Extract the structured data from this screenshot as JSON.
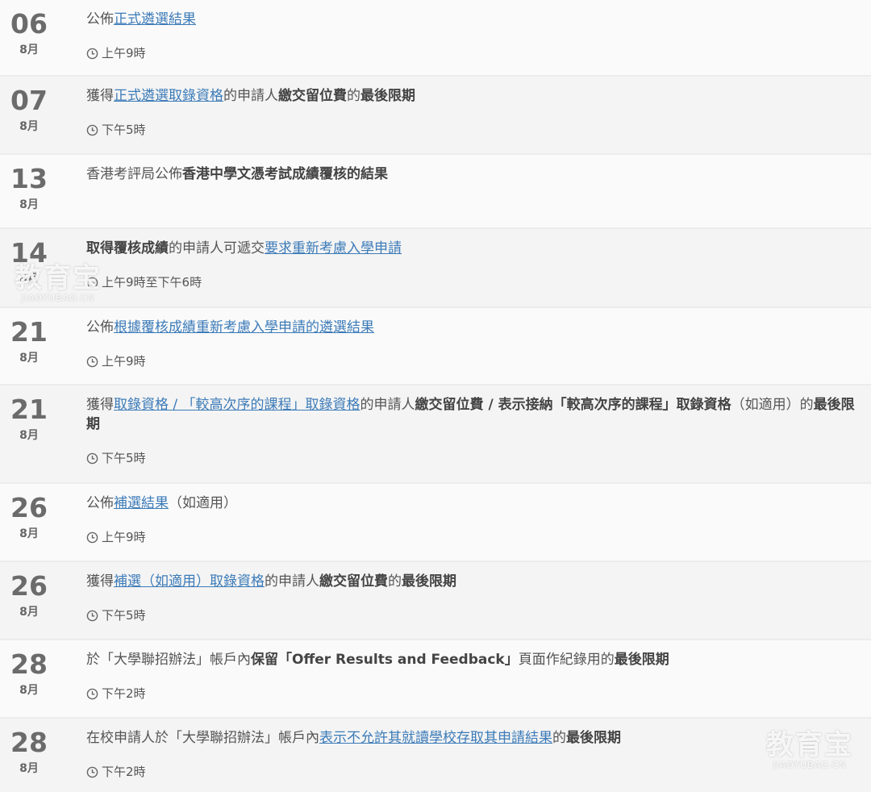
{
  "events": [
    {
      "day": "06",
      "month": "8月",
      "parts": [
        {
          "t": "text",
          "v": "公佈"
        },
        {
          "t": "link",
          "v": "正式遴選結果"
        }
      ],
      "time": "上午9時"
    },
    {
      "day": "07",
      "month": "8月",
      "parts": [
        {
          "t": "text",
          "v": "獲得"
        },
        {
          "t": "link",
          "v": "正式遴選取錄資格"
        },
        {
          "t": "text",
          "v": "的申請人"
        },
        {
          "t": "bold",
          "v": "繳交留位費"
        },
        {
          "t": "text",
          "v": "的"
        },
        {
          "t": "bold",
          "v": "最後限期"
        }
      ],
      "time": "下午5時"
    },
    {
      "day": "13",
      "month": "8月",
      "parts": [
        {
          "t": "text",
          "v": "香港考評局公佈"
        },
        {
          "t": "bold",
          "v": "香港中學文憑考試成績覆核的結果"
        }
      ],
      "time": ""
    },
    {
      "day": "14",
      "month": "8月",
      "parts": [
        {
          "t": "bold",
          "v": "取得覆核成績"
        },
        {
          "t": "text",
          "v": "的申請人可遞交"
        },
        {
          "t": "link",
          "v": "要求重新考慮入學申請"
        }
      ],
      "time": "上午9時至下午6時"
    },
    {
      "day": "21",
      "month": "8月",
      "parts": [
        {
          "t": "text",
          "v": "公佈"
        },
        {
          "t": "link",
          "v": "根據覆核成績重新考慮入學申請的遴選結果"
        }
      ],
      "time": "上午9時"
    },
    {
      "day": "21",
      "month": "8月",
      "parts": [
        {
          "t": "text",
          "v": "獲得"
        },
        {
          "t": "link",
          "v": "取錄資格 / 「較高次序的課程」取錄資格"
        },
        {
          "t": "text",
          "v": "的申請人"
        },
        {
          "t": "bold",
          "v": "繳交留位費 / 表示接納「較高次序的課程」取錄資格"
        },
        {
          "t": "text",
          "v": "（如適用）的"
        },
        {
          "t": "bold",
          "v": "最後限期"
        }
      ],
      "time": "下午5時"
    },
    {
      "day": "26",
      "month": "8月",
      "parts": [
        {
          "t": "text",
          "v": "公佈"
        },
        {
          "t": "link",
          "v": "補選結果"
        },
        {
          "t": "text",
          "v": "（如適用）"
        }
      ],
      "time": "上午9時"
    },
    {
      "day": "26",
      "month": "8月",
      "parts": [
        {
          "t": "text",
          "v": "獲得"
        },
        {
          "t": "link",
          "v": "補選（如適用）取錄資格"
        },
        {
          "t": "text",
          "v": "的申請人"
        },
        {
          "t": "bold",
          "v": "繳交留位費"
        },
        {
          "t": "text",
          "v": "的"
        },
        {
          "t": "bold",
          "v": "最後限期"
        }
      ],
      "time": "下午5時"
    },
    {
      "day": "28",
      "month": "8月",
      "parts": [
        {
          "t": "text",
          "v": "於「大學聯招辦法」帳戶內"
        },
        {
          "t": "bold",
          "v": "保留「Offer Results and Feedback」"
        },
        {
          "t": "text",
          "v": "頁面作紀錄用的"
        },
        {
          "t": "bold",
          "v": "最後限期"
        }
      ],
      "time": "下午2時"
    },
    {
      "day": "28",
      "month": "8月",
      "parts": [
        {
          "t": "text",
          "v": "在校申請人於「大學聯招辦法」帳戶內"
        },
        {
          "t": "link",
          "v": "表示不允許其就讀學校存取其申請結果"
        },
        {
          "t": "text",
          "v": "的"
        },
        {
          "t": "bold",
          "v": "最後限期"
        }
      ],
      "time": "下午2時"
    }
  ],
  "watermark": {
    "title": "教育宝",
    "subtitle": "JIAOYUBAO.CN"
  },
  "colors": {
    "link": "#3c7bb8",
    "date": "#6b6b6b",
    "row_bg": "#fafafa",
    "row_bg_alt": "#f4f4f4"
  }
}
